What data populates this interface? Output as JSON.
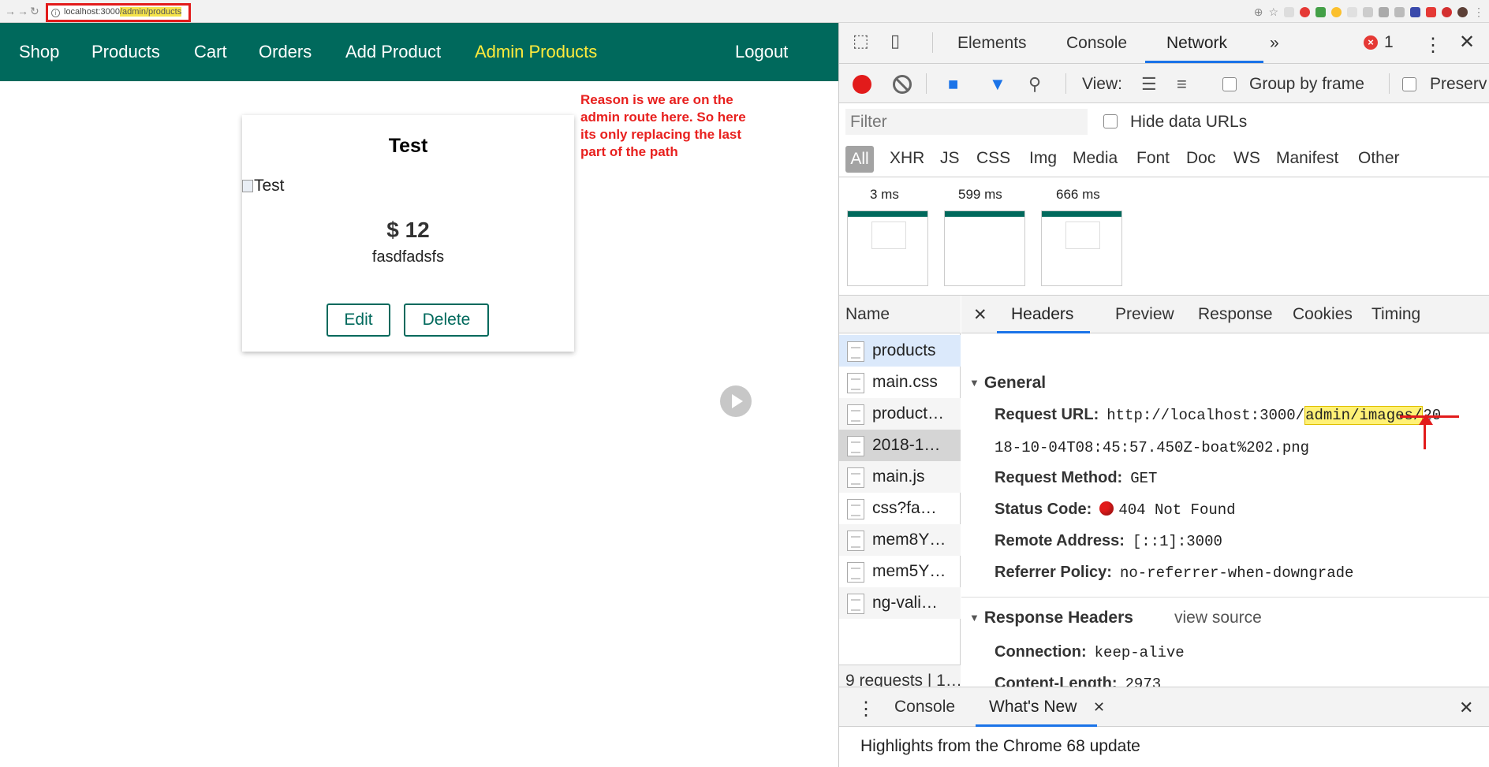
{
  "browser": {
    "url_host": "localhost:3000",
    "url_path": "/admin/products"
  },
  "nav": {
    "links": [
      "Shop",
      "Products",
      "Cart",
      "Orders",
      "Add Product",
      "Admin Products"
    ],
    "logout": "Logout",
    "active_color": "#ffeb3b",
    "bar_color": "#00695c"
  },
  "product": {
    "title": "Test",
    "image_alt": "Test",
    "price": "$ 12",
    "description": "fasdfadsfs",
    "edit_label": "Edit",
    "delete_label": "Delete"
  },
  "annotation": {
    "lines": [
      "Reason is we are on the",
      "admin route here. So here",
      "its only replacing the last",
      "part of the path"
    ]
  },
  "devtools": {
    "tabs": [
      "Elements",
      "Console",
      "Network"
    ],
    "more": "»",
    "error_count": "1",
    "toolbar": {
      "view_label": "View:",
      "group_by_frame": "Group by frame",
      "preserve": "Preserv"
    },
    "filter_placeholder": "Filter",
    "hide_data_urls": "Hide data URLs",
    "types": [
      "All",
      "XHR",
      "JS",
      "CSS",
      "Img",
      "Media",
      "Font",
      "Doc",
      "WS",
      "Manifest",
      "Other"
    ],
    "filmstrip": [
      "3 ms",
      "599 ms",
      "666 ms"
    ],
    "name_header": "Name",
    "requests": [
      "products",
      "main.css",
      "product…",
      "2018-1…",
      "main.js",
      "css?fa…",
      "mem8Y…",
      "mem5Y…",
      "ng-vali…"
    ],
    "footer": "9 requests | 1…",
    "detail_tabs": [
      "Headers",
      "Preview",
      "Response",
      "Cookies",
      "Timing"
    ],
    "general": {
      "title": "General",
      "request_url_label": "Request URL:",
      "request_url_pre": "http://localhost:3000/",
      "request_url_hl": "admin/images/",
      "request_url_post": "20",
      "request_url_line2": "18-10-04T08:45:57.450Z-boat%202.png",
      "method_label": "Request Method:",
      "method": "GET",
      "status_label": "Status Code:",
      "status": "404 Not Found",
      "remote_label": "Remote Address:",
      "remote": "[::1]:3000",
      "referrer_label": "Referrer Policy:",
      "referrer": "no-referrer-when-downgrade"
    },
    "response_headers": {
      "title": "Response Headers",
      "view_source": "view source",
      "connection_label": "Connection:",
      "connection": "keep-alive",
      "length_label": "Content-Length:",
      "length": "2973"
    },
    "drawer": {
      "tabs": [
        "Console",
        "What's New"
      ],
      "body": "Highlights from the Chrome 68 update"
    }
  }
}
